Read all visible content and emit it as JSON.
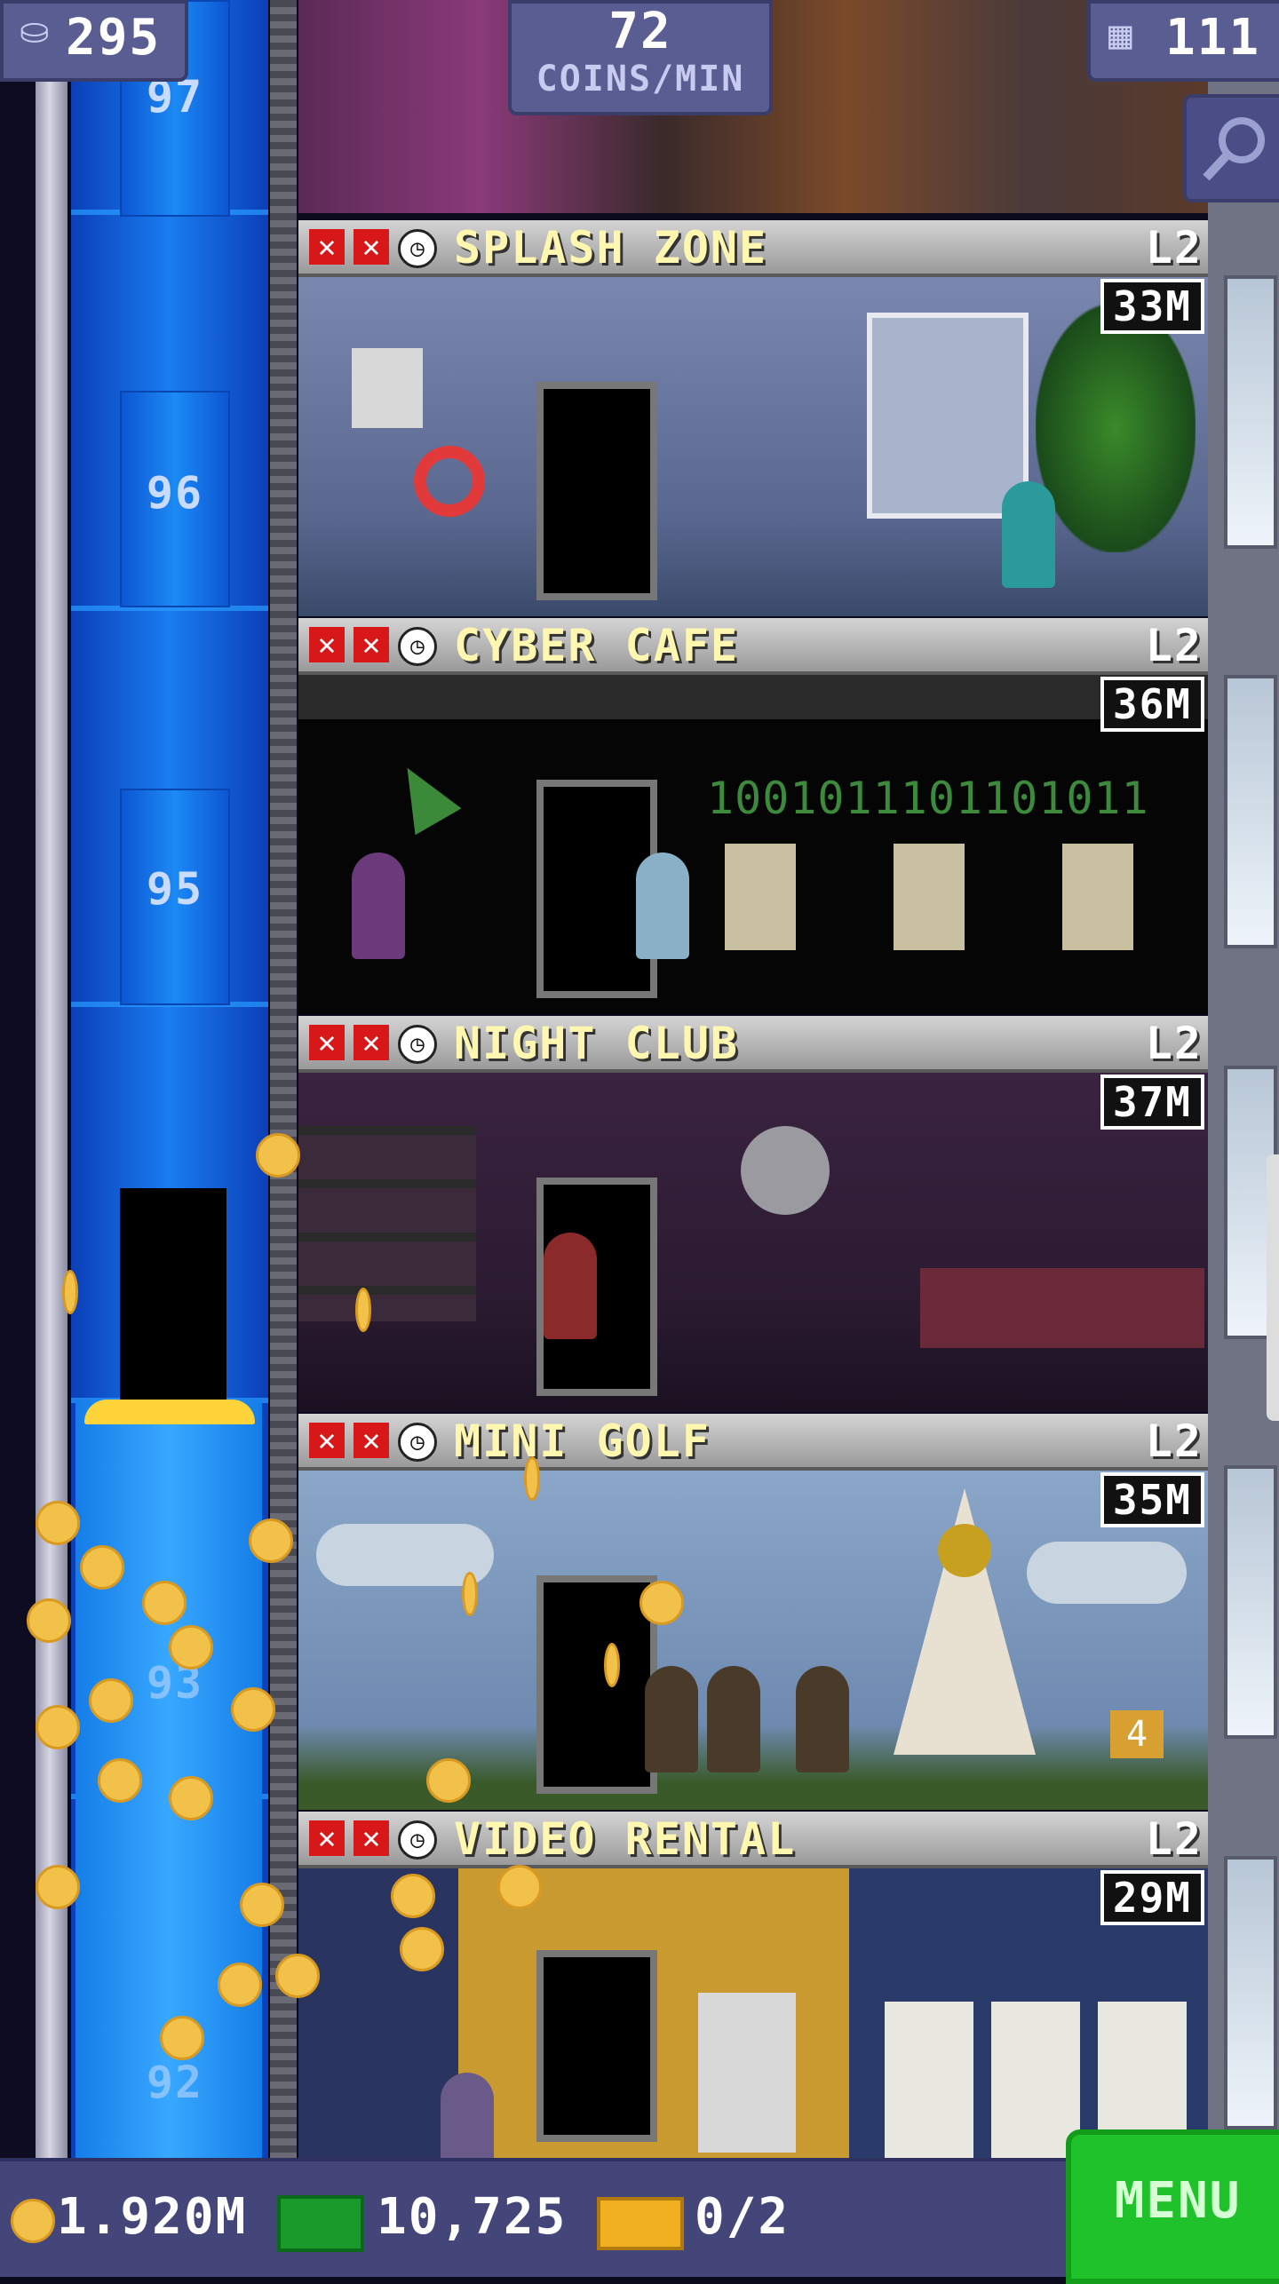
{
  "hud": {
    "population": "295",
    "coins_per_min_value": "72",
    "coins_per_min_label": "COINS/MIN",
    "floor_count": "111"
  },
  "shaft": {
    "numbers": [
      "97",
      "96",
      "95",
      "93",
      "92"
    ]
  },
  "floors": [
    {
      "name": "SPLASH ZONE",
      "level": "L2",
      "price": "33M"
    },
    {
      "name": "CYBER CAFE",
      "level": "L2",
      "price": "36M",
      "binary_text": "1001011101101011"
    },
    {
      "name": "NIGHT CLUB",
      "level": "L2",
      "price": "37M"
    },
    {
      "name": "MINI GOLF",
      "level": "L2",
      "price": "35M",
      "hole_number": "4"
    },
    {
      "name": "VIDEO RENTAL",
      "level": "L2",
      "price": "29M"
    }
  ],
  "bottom": {
    "coins": "1.920M",
    "bux": "10,725",
    "tickets": "0/2",
    "menu_label": "MENU"
  },
  "colors": {
    "shaft_blue": "#1a7cf0",
    "hud_bg": "#5a5d92",
    "menu_green": "#1fc22a",
    "coin_gold": "#f2c14a",
    "floor_title": "#fff7b0"
  }
}
